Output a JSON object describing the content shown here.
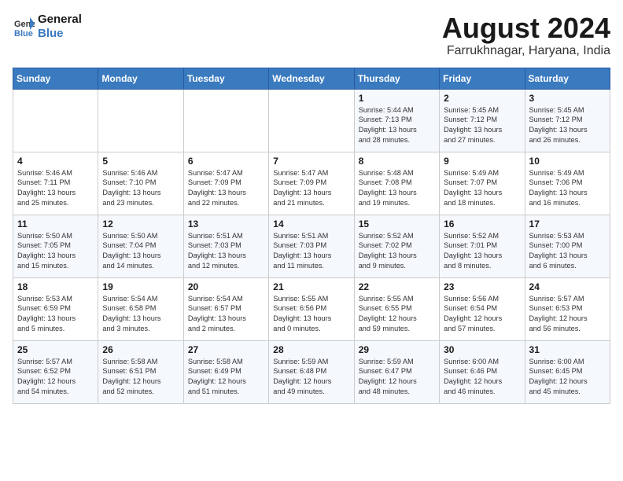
{
  "header": {
    "logo_line1": "General",
    "logo_line2": "Blue",
    "month_year": "August 2024",
    "location": "Farrukhnagar, Haryana, India"
  },
  "weekdays": [
    "Sunday",
    "Monday",
    "Tuesday",
    "Wednesday",
    "Thursday",
    "Friday",
    "Saturday"
  ],
  "weeks": [
    [
      {
        "day": "",
        "info": ""
      },
      {
        "day": "",
        "info": ""
      },
      {
        "day": "",
        "info": ""
      },
      {
        "day": "",
        "info": ""
      },
      {
        "day": "1",
        "info": "Sunrise: 5:44 AM\nSunset: 7:13 PM\nDaylight: 13 hours\nand 28 minutes."
      },
      {
        "day": "2",
        "info": "Sunrise: 5:45 AM\nSunset: 7:12 PM\nDaylight: 13 hours\nand 27 minutes."
      },
      {
        "day": "3",
        "info": "Sunrise: 5:45 AM\nSunset: 7:12 PM\nDaylight: 13 hours\nand 26 minutes."
      }
    ],
    [
      {
        "day": "4",
        "info": "Sunrise: 5:46 AM\nSunset: 7:11 PM\nDaylight: 13 hours\nand 25 minutes."
      },
      {
        "day": "5",
        "info": "Sunrise: 5:46 AM\nSunset: 7:10 PM\nDaylight: 13 hours\nand 23 minutes."
      },
      {
        "day": "6",
        "info": "Sunrise: 5:47 AM\nSunset: 7:09 PM\nDaylight: 13 hours\nand 22 minutes."
      },
      {
        "day": "7",
        "info": "Sunrise: 5:47 AM\nSunset: 7:09 PM\nDaylight: 13 hours\nand 21 minutes."
      },
      {
        "day": "8",
        "info": "Sunrise: 5:48 AM\nSunset: 7:08 PM\nDaylight: 13 hours\nand 19 minutes."
      },
      {
        "day": "9",
        "info": "Sunrise: 5:49 AM\nSunset: 7:07 PM\nDaylight: 13 hours\nand 18 minutes."
      },
      {
        "day": "10",
        "info": "Sunrise: 5:49 AM\nSunset: 7:06 PM\nDaylight: 13 hours\nand 16 minutes."
      }
    ],
    [
      {
        "day": "11",
        "info": "Sunrise: 5:50 AM\nSunset: 7:05 PM\nDaylight: 13 hours\nand 15 minutes."
      },
      {
        "day": "12",
        "info": "Sunrise: 5:50 AM\nSunset: 7:04 PM\nDaylight: 13 hours\nand 14 minutes."
      },
      {
        "day": "13",
        "info": "Sunrise: 5:51 AM\nSunset: 7:03 PM\nDaylight: 13 hours\nand 12 minutes."
      },
      {
        "day": "14",
        "info": "Sunrise: 5:51 AM\nSunset: 7:03 PM\nDaylight: 13 hours\nand 11 minutes."
      },
      {
        "day": "15",
        "info": "Sunrise: 5:52 AM\nSunset: 7:02 PM\nDaylight: 13 hours\nand 9 minutes."
      },
      {
        "day": "16",
        "info": "Sunrise: 5:52 AM\nSunset: 7:01 PM\nDaylight: 13 hours\nand 8 minutes."
      },
      {
        "day": "17",
        "info": "Sunrise: 5:53 AM\nSunset: 7:00 PM\nDaylight: 13 hours\nand 6 minutes."
      }
    ],
    [
      {
        "day": "18",
        "info": "Sunrise: 5:53 AM\nSunset: 6:59 PM\nDaylight: 13 hours\nand 5 minutes."
      },
      {
        "day": "19",
        "info": "Sunrise: 5:54 AM\nSunset: 6:58 PM\nDaylight: 13 hours\nand 3 minutes."
      },
      {
        "day": "20",
        "info": "Sunrise: 5:54 AM\nSunset: 6:57 PM\nDaylight: 13 hours\nand 2 minutes."
      },
      {
        "day": "21",
        "info": "Sunrise: 5:55 AM\nSunset: 6:56 PM\nDaylight: 13 hours\nand 0 minutes."
      },
      {
        "day": "22",
        "info": "Sunrise: 5:55 AM\nSunset: 6:55 PM\nDaylight: 12 hours\nand 59 minutes."
      },
      {
        "day": "23",
        "info": "Sunrise: 5:56 AM\nSunset: 6:54 PM\nDaylight: 12 hours\nand 57 minutes."
      },
      {
        "day": "24",
        "info": "Sunrise: 5:57 AM\nSunset: 6:53 PM\nDaylight: 12 hours\nand 56 minutes."
      }
    ],
    [
      {
        "day": "25",
        "info": "Sunrise: 5:57 AM\nSunset: 6:52 PM\nDaylight: 12 hours\nand 54 minutes."
      },
      {
        "day": "26",
        "info": "Sunrise: 5:58 AM\nSunset: 6:51 PM\nDaylight: 12 hours\nand 52 minutes."
      },
      {
        "day": "27",
        "info": "Sunrise: 5:58 AM\nSunset: 6:49 PM\nDaylight: 12 hours\nand 51 minutes."
      },
      {
        "day": "28",
        "info": "Sunrise: 5:59 AM\nSunset: 6:48 PM\nDaylight: 12 hours\nand 49 minutes."
      },
      {
        "day": "29",
        "info": "Sunrise: 5:59 AM\nSunset: 6:47 PM\nDaylight: 12 hours\nand 48 minutes."
      },
      {
        "day": "30",
        "info": "Sunrise: 6:00 AM\nSunset: 6:46 PM\nDaylight: 12 hours\nand 46 minutes."
      },
      {
        "day": "31",
        "info": "Sunrise: 6:00 AM\nSunset: 6:45 PM\nDaylight: 12 hours\nand 45 minutes."
      }
    ]
  ]
}
